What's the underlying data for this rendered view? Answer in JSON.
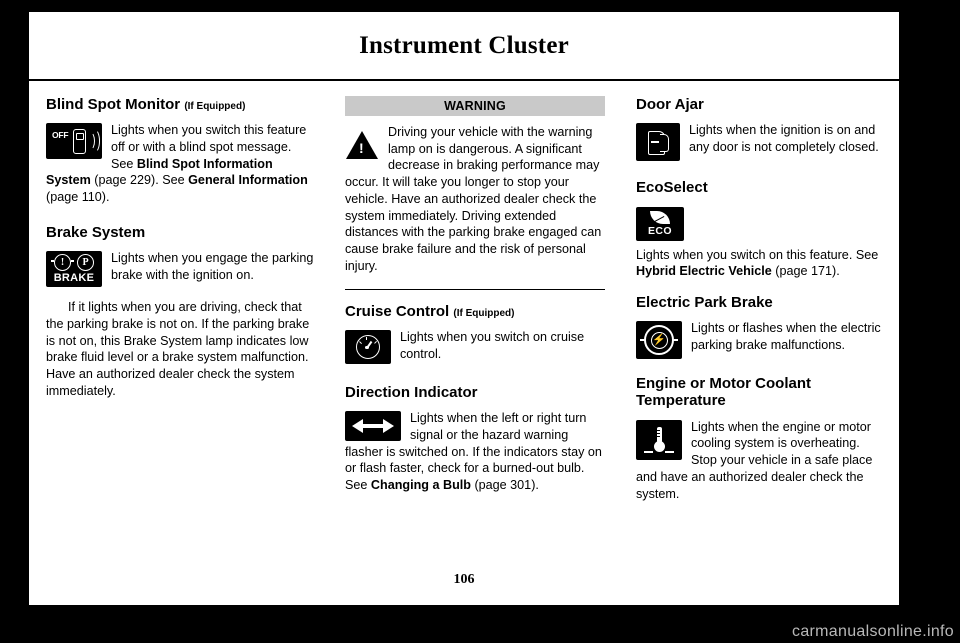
{
  "page": {
    "header_title": "Instrument Cluster",
    "page_number": "106",
    "watermark": "carmanualsonline.info"
  },
  "column1": {
    "blind_spot": {
      "heading": "Blind Spot Monitor",
      "heading_note": "(If Equipped)",
      "icon": "blind-spot-monitor-off-icon",
      "icon_label": "OFF",
      "text_1": "Lights when you switch this feature off or with a blind spot message.  See ",
      "bold_1": "Blind Spot Information System",
      "text_2": " (page 229).   See ",
      "bold_2": "General Information",
      "text_3": " (page 110)."
    },
    "brake_system": {
      "heading": "Brake System",
      "icon": "brake-warning-icon",
      "icon_label": "BRAKE",
      "text_1": "Lights when you engage the parking brake with the ignition on.",
      "text_2": "If it lights when you are driving, check that the parking brake is not on. If the parking brake is not on, this Brake System lamp indicates low brake fluid level or a brake system malfunction. Have an authorized dealer check the system immediately."
    }
  },
  "column2": {
    "warning_bar": "WARNING",
    "warning": {
      "icon": "warning-triangle-icon",
      "text": "Driving your vehicle with the warning lamp on is dangerous. A significant decrease in braking performance may occur. It will take you longer to stop your vehicle. Have an authorized dealer check the system immediately. Driving extended distances with the parking brake engaged can cause brake failure and the risk of personal injury."
    },
    "cruise_control": {
      "heading": "Cruise Control",
      "heading_note": "(If Equipped)",
      "icon": "cruise-control-icon",
      "text": "Lights when you switch on cruise control."
    },
    "direction_indicator": {
      "heading": "Direction Indicator",
      "icon": "direction-indicator-icon",
      "text_1": "Lights when the left or right turn signal or the hazard warning flasher is switched on. If the indicators stay on or flash faster, check for a burned-out bulb.  See ",
      "bold_1": "Changing a Bulb",
      "text_2": " (page 301)."
    }
  },
  "column3": {
    "door_ajar": {
      "heading": "Door Ajar",
      "icon": "door-ajar-icon",
      "text": "Lights when the ignition is on and any door is not completely closed."
    },
    "ecoselect": {
      "heading": "EcoSelect",
      "icon": "eco-leaf-icon",
      "icon_label": "ECO",
      "text_1": "Lights when you switch on this feature.  See ",
      "bold_1": "Hybrid Electric Vehicle",
      "text_2": " (page 171)."
    },
    "electric_park_brake": {
      "heading": "Electric Park Brake",
      "icon": "electric-park-brake-icon",
      "text": "Lights or flashes when the electric parking brake malfunctions."
    },
    "coolant_temp": {
      "heading": "Engine or Motor Coolant Temperature",
      "icon": "coolant-temperature-icon",
      "text": "Lights when the engine or motor cooling system is overheating. Stop your vehicle in a safe place and have an authorized dealer check the system."
    }
  }
}
